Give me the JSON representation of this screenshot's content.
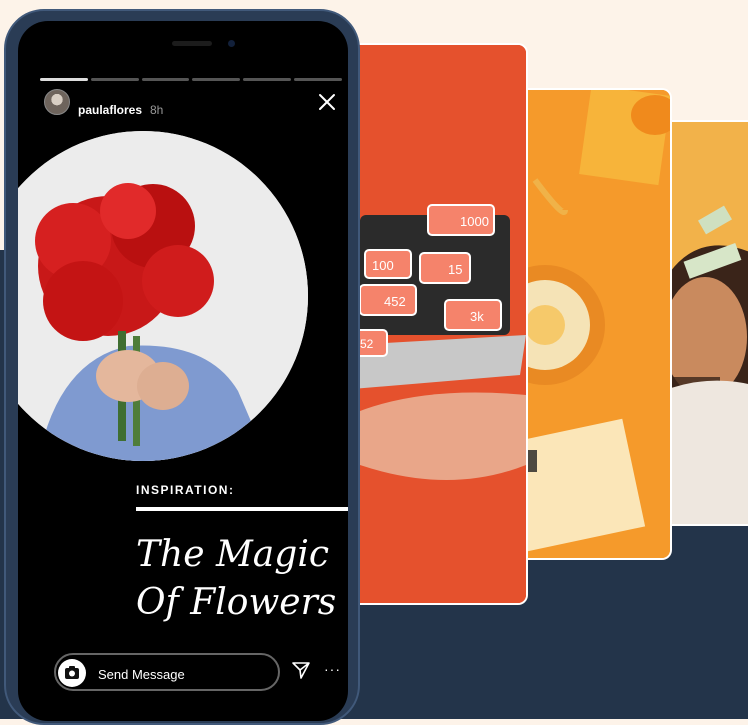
{
  "story": {
    "username": "paulaflores",
    "time": "8h",
    "label": "INSPIRATION:",
    "title_line1": "The Magic",
    "title_line2": "Of Flowers",
    "message_placeholder": "Send Message",
    "more_label": "···",
    "progress_segments": 6,
    "active_segment_index": 0
  },
  "cards": {
    "laptop_card": {
      "badges": [
        "1000",
        "100",
        "15",
        "452",
        "3k",
        "52"
      ]
    }
  },
  "colors": {
    "background_top": "#fdf3e9",
    "background_bottom": "#23344a",
    "card_laptop": "#e5512d",
    "card_desk": "#f59a2b",
    "card_person": "#f2b24a",
    "badge": "#f5836b"
  },
  "icons": [
    "close-icon",
    "camera-icon",
    "send-icon",
    "more-icon",
    "heart-icon"
  ]
}
